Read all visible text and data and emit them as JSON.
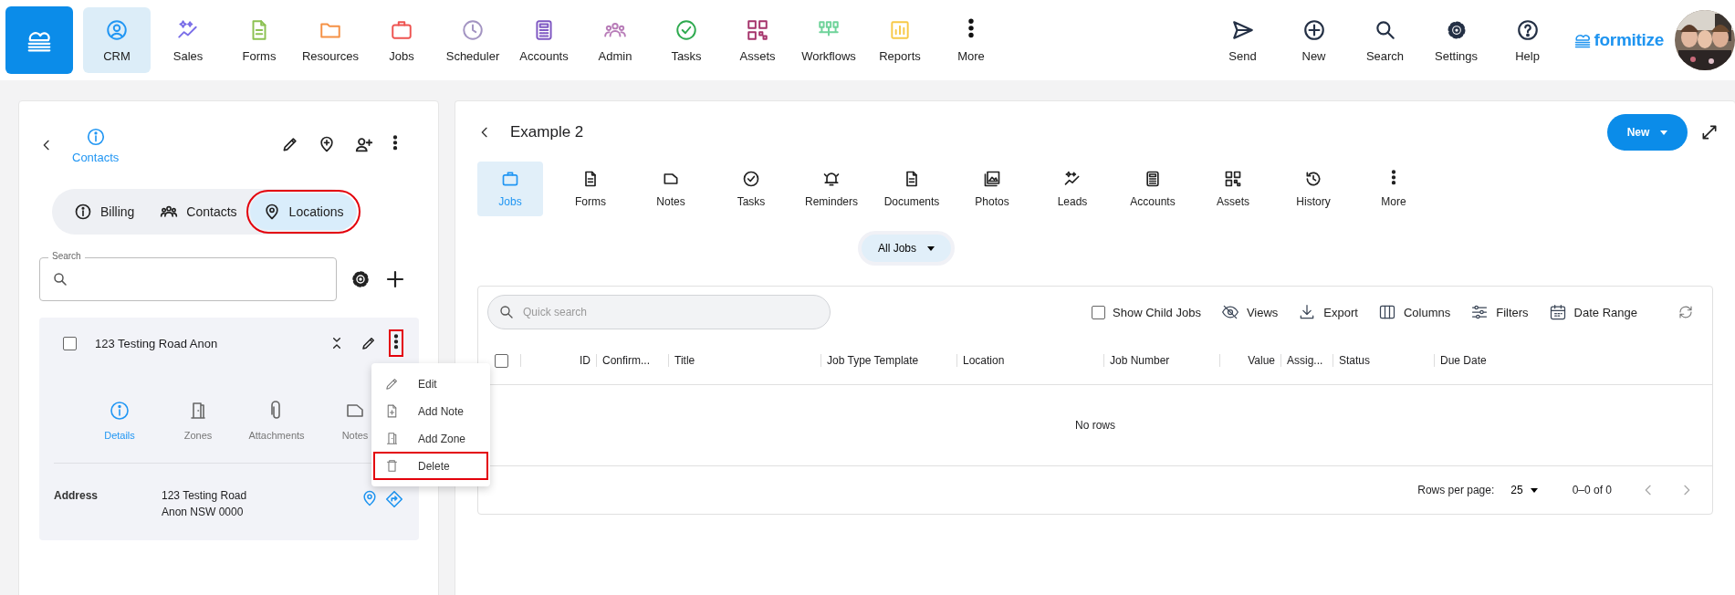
{
  "top_nav": {
    "items": [
      {
        "label": "CRM",
        "selected": true
      },
      {
        "label": "Sales",
        "selected": false
      },
      {
        "label": "Forms",
        "selected": false
      },
      {
        "label": "Resources",
        "selected": false
      },
      {
        "label": "Jobs",
        "selected": false
      },
      {
        "label": "Scheduler",
        "selected": false
      },
      {
        "label": "Accounts",
        "selected": false
      },
      {
        "label": "Admin",
        "selected": false
      },
      {
        "label": "Tasks",
        "selected": false
      },
      {
        "label": "Assets",
        "selected": false
      },
      {
        "label": "Workflows",
        "selected": false
      },
      {
        "label": "Reports",
        "selected": false
      },
      {
        "label": "More",
        "selected": false
      }
    ],
    "actions": [
      {
        "label": "Send"
      },
      {
        "label": "New"
      },
      {
        "label": "Search"
      },
      {
        "label": "Settings"
      },
      {
        "label": "Help"
      }
    ],
    "brand": "formitize"
  },
  "side_panel": {
    "header": {
      "label": "Contacts"
    },
    "tabs": [
      {
        "label": "Billing",
        "selected": false,
        "highlighted": false
      },
      {
        "label": "Contacts",
        "selected": false,
        "highlighted": false
      },
      {
        "label": "Locations",
        "selected": true,
        "highlighted": true
      }
    ],
    "search": {
      "label": "Search"
    },
    "location": {
      "title": "123 Testing Road Anon",
      "checked": false,
      "menu_highlighted": true,
      "sub_tabs": [
        {
          "label": "Details",
          "selected": true
        },
        {
          "label": "Zones",
          "selected": false
        },
        {
          "label": "Attachments",
          "selected": false
        },
        {
          "label": "Notes",
          "selected": false
        }
      ],
      "fields": [
        {
          "label": "Address",
          "lines": [
            "123 Testing Road",
            "Anon NSW 0000"
          ]
        }
      ]
    },
    "context_menu": [
      {
        "label": "Edit",
        "highlighted": false
      },
      {
        "label": "Add Note",
        "highlighted": false
      },
      {
        "label": "Add Zone",
        "highlighted": false
      },
      {
        "label": "Delete",
        "highlighted": true
      }
    ]
  },
  "record": {
    "title": "Example 2",
    "new_button": "New",
    "tabs": [
      {
        "label": "Jobs",
        "selected": true
      },
      {
        "label": "Forms",
        "selected": false
      },
      {
        "label": "Notes",
        "selected": false
      },
      {
        "label": "Tasks",
        "selected": false
      },
      {
        "label": "Reminders",
        "selected": false
      },
      {
        "label": "Documents",
        "selected": false
      },
      {
        "label": "Photos",
        "selected": false
      },
      {
        "label": "Leads",
        "selected": false
      },
      {
        "label": "Accounts",
        "selected": false
      },
      {
        "label": "Assets",
        "selected": false
      },
      {
        "label": "History",
        "selected": false
      },
      {
        "label": "More",
        "selected": false
      }
    ],
    "filter": "All Jobs",
    "table": {
      "search_placeholder": "Quick search",
      "toolbar": [
        {
          "label": "Show Child Jobs",
          "kind": "checkbox",
          "checked": false
        },
        {
          "label": "Views",
          "kind": "button"
        },
        {
          "label": "Export",
          "kind": "button"
        },
        {
          "label": "Columns",
          "kind": "button"
        },
        {
          "label": "Filters",
          "kind": "button"
        },
        {
          "label": "Date Range",
          "kind": "button"
        }
      ],
      "columns": [
        "ID",
        "Confirm...",
        "Title",
        "Job Type Template",
        "Location",
        "Job Number",
        "Value",
        "Assig...",
        "Status",
        "Due Date"
      ],
      "select_all_checked": false,
      "empty_text": "No rows",
      "footer": {
        "rows_per_page_label": "Rows per page:",
        "rows_per_page": "25",
        "range": "0–0 of 0"
      }
    }
  }
}
